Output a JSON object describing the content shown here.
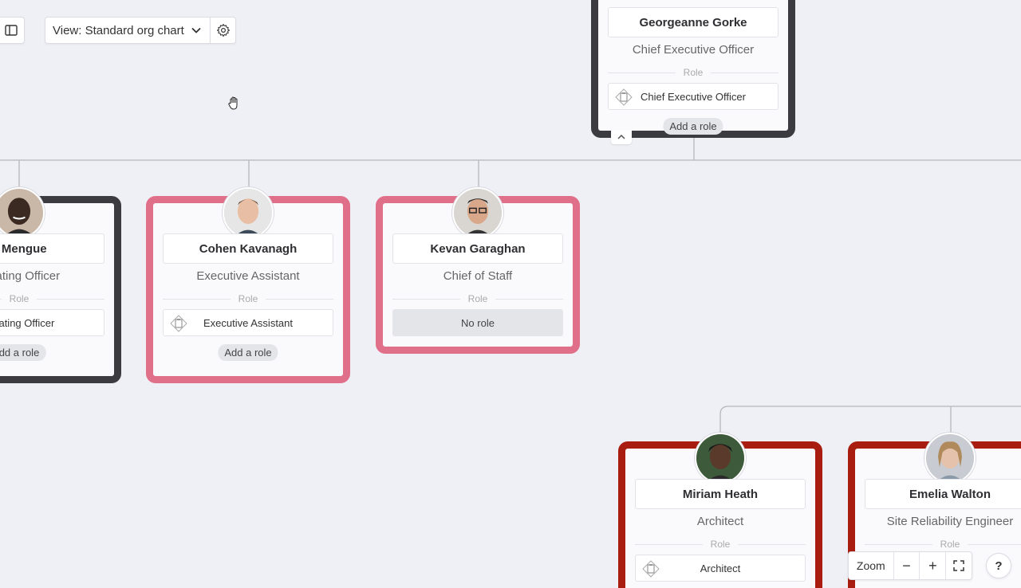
{
  "toolbar": {
    "panel_icon": "sidebar-panel-icon",
    "view_label": "View: Standard org chart",
    "settings_icon": "gear-icon"
  },
  "role_section_label": "Role",
  "cards": {
    "ceo": {
      "name": "Georgeanne Gorke",
      "title": "Chief Executive Officer",
      "role": "Chief Executive Officer",
      "add_role": "Add a role"
    },
    "coo": {
      "name": "y Mengue",
      "title": "perating Officer",
      "role": "perating Officer",
      "add_role": "dd a role"
    },
    "ea": {
      "name": "Cohen Kavanagh",
      "title": "Executive Assistant",
      "role": "Executive Assistant",
      "add_role": "Add a role"
    },
    "cos": {
      "name": "Kevan Garaghan",
      "title": "Chief of Staff",
      "role": "No role"
    },
    "architect": {
      "name": "Miriam Heath",
      "title": "Architect",
      "role": "Architect"
    },
    "sre": {
      "name": "Emelia Walton",
      "title": "Site Reliability Engineer"
    }
  },
  "zoom": {
    "label": "Zoom",
    "minus": "−",
    "plus": "+",
    "fullscreen_icon": "fullscreen-icon"
  },
  "help": "?",
  "colors": {
    "background": "#eff0f5",
    "card_dark_border": "#3b3b40",
    "card_pink_border": "#e07089",
    "card_red_border": "#a81d10",
    "connector": "#b5b6bd"
  }
}
